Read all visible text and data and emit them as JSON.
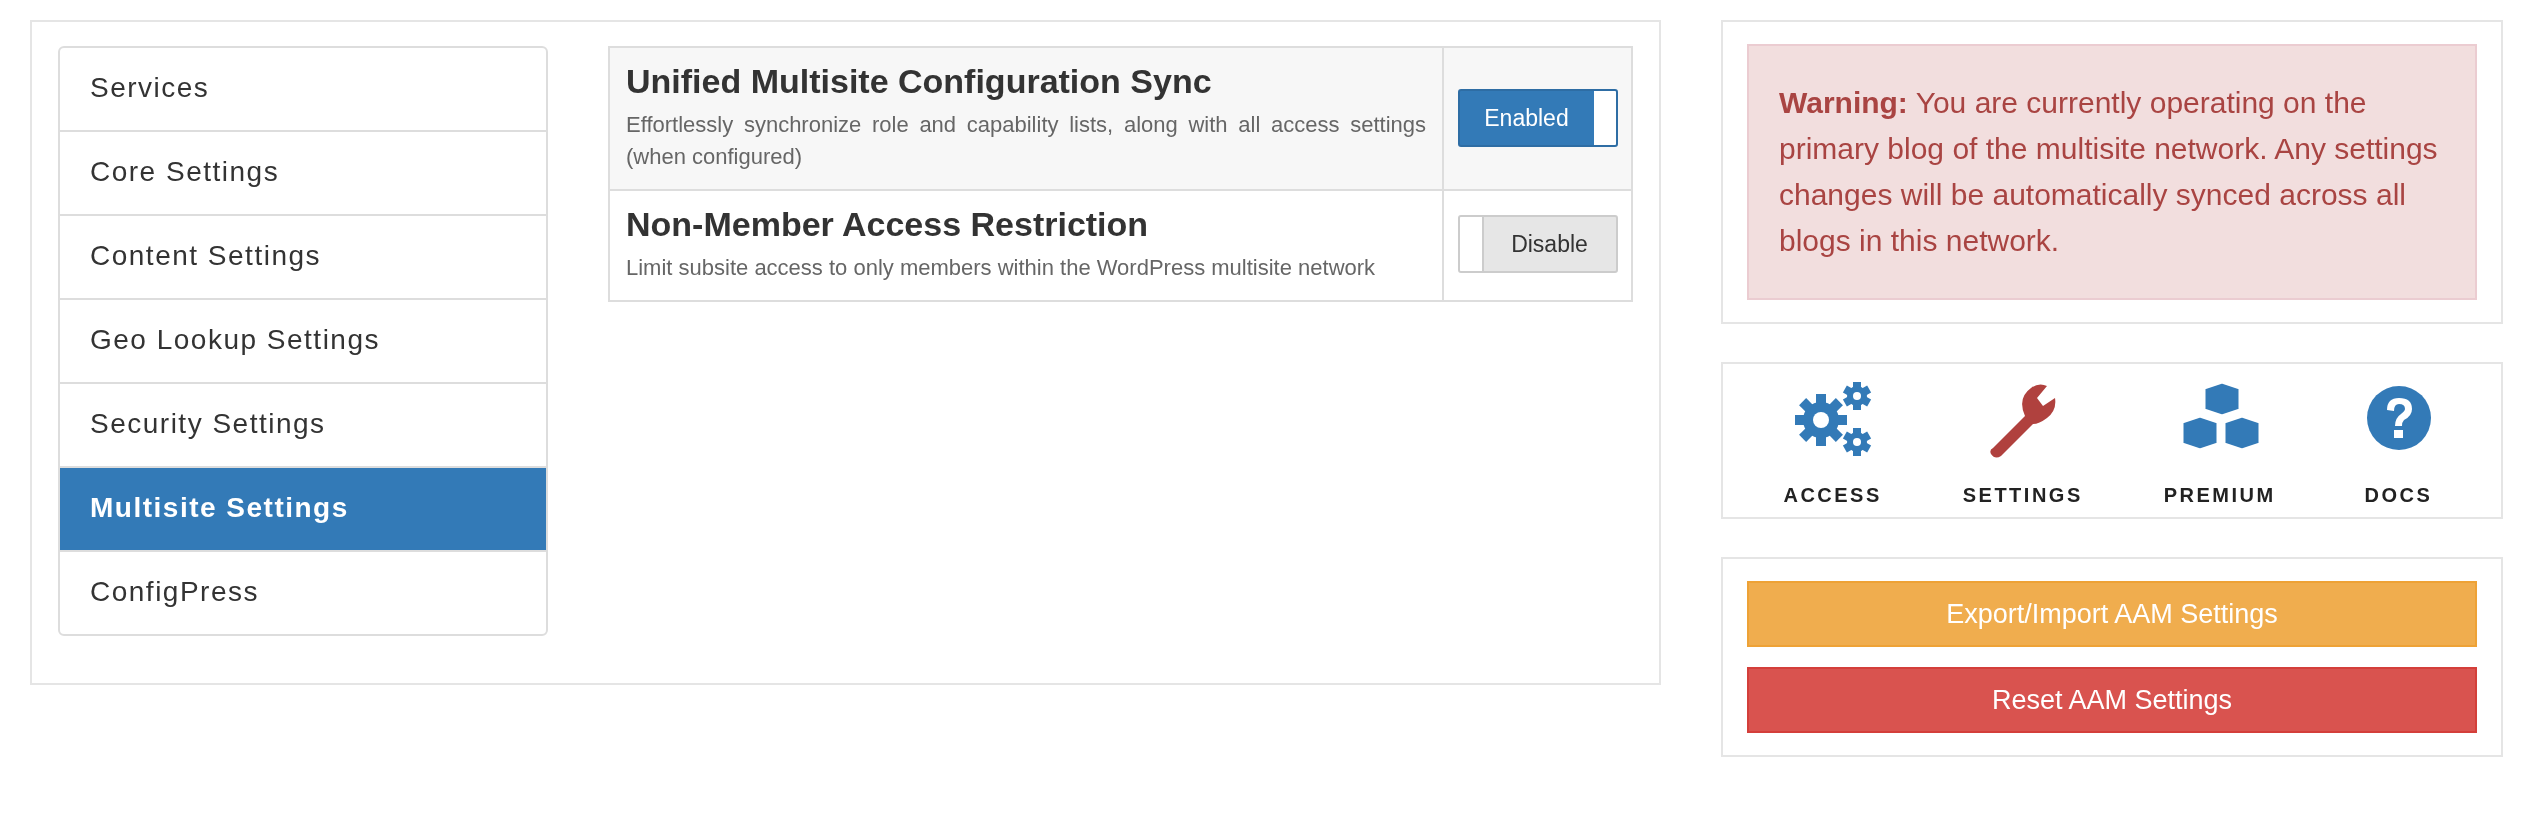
{
  "menu": {
    "items": [
      {
        "label": "Services",
        "selected": false
      },
      {
        "label": "Core Settings",
        "selected": false
      },
      {
        "label": "Content Settings",
        "selected": false
      },
      {
        "label": "Geo Lookup Settings",
        "selected": false
      },
      {
        "label": "Security Settings",
        "selected": false
      },
      {
        "label": "Multisite Settings",
        "selected": true
      },
      {
        "label": "ConfigPress",
        "selected": false
      }
    ]
  },
  "settings": [
    {
      "title": "Unified Multisite Configuration Sync",
      "description": "Effortlessly synchronize role and capability lists, along with all access settings (when configured)",
      "toggle": {
        "label": "Enabled",
        "on": true
      }
    },
    {
      "title": "Non-Member Access Restriction",
      "description": "Limit subsite access to only members within the WordPress multisite network",
      "toggle": {
        "label": "Disable",
        "on": false
      }
    }
  ],
  "warning": "**Warning:** You are currently operating on the primary blog of the multisite network. Any settings changes will be automatically synced across all blogs in this network.",
  "shortcuts": [
    {
      "kind": "gears",
      "label": "ACCESS"
    },
    {
      "kind": "wrench",
      "label": "SETTINGS"
    },
    {
      "kind": "cubes",
      "label": "PREMIUM"
    },
    {
      "kind": "question",
      "label": "DOCS"
    }
  ],
  "actions": [
    {
      "kind": "warning",
      "label": "Export/Import AAM Settings"
    },
    {
      "kind": "danger",
      "label": "Reset AAM Settings"
    }
  ]
}
